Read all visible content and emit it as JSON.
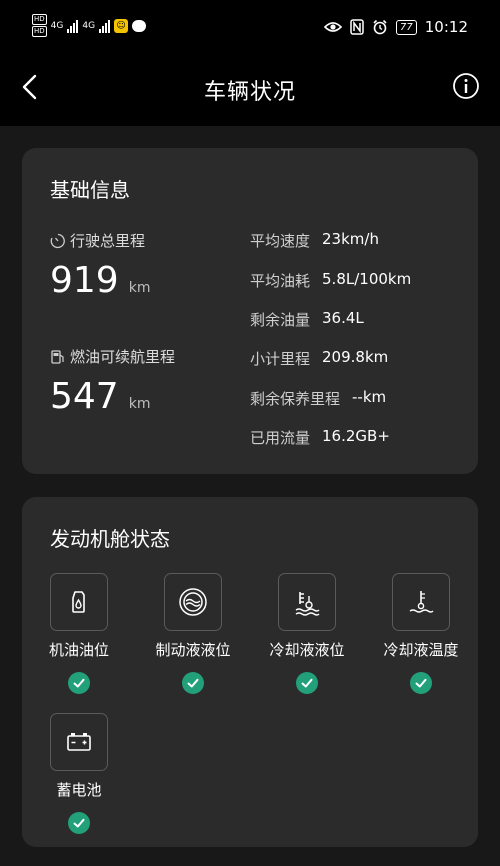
{
  "status_bar": {
    "left_hd1": "HD",
    "left_hd2": "HD",
    "net1": "4G",
    "net2": "4G",
    "battery": "77",
    "time": "10:12"
  },
  "header": {
    "title": "车辆状况"
  },
  "basic_info": {
    "title": "基础信息",
    "total_mileage_label": "行驶总里程",
    "total_mileage_value": "919",
    "total_mileage_unit": "km",
    "range_label": "燃油可续航里程",
    "range_value": "547",
    "range_unit": "km",
    "rows": [
      {
        "key": "平均速度",
        "value": "23km/h"
      },
      {
        "key": "平均油耗",
        "value": "5.8L/100km"
      },
      {
        "key": "剩余油量",
        "value": "36.4L"
      },
      {
        "key": "小计里程",
        "value": "209.8km"
      },
      {
        "key": "剩余保养里程",
        "value": "--km"
      },
      {
        "key": "已用流量",
        "value": "16.2GB+"
      }
    ]
  },
  "engine_status": {
    "title": "发动机舱状态",
    "items": [
      {
        "label": "机油油位",
        "icon": "oil-level-icon"
      },
      {
        "label": "制动液液位",
        "icon": "brake-fluid-icon"
      },
      {
        "label": "冷却液液位",
        "icon": "coolant-level-icon"
      },
      {
        "label": "冷却液温度",
        "icon": "coolant-temp-icon"
      },
      {
        "label": "蓄电池",
        "icon": "battery-icon"
      }
    ]
  },
  "colors": {
    "ok_green": "#22a079",
    "card_bg": "#2b2b2b",
    "page_bg": "#181818"
  }
}
